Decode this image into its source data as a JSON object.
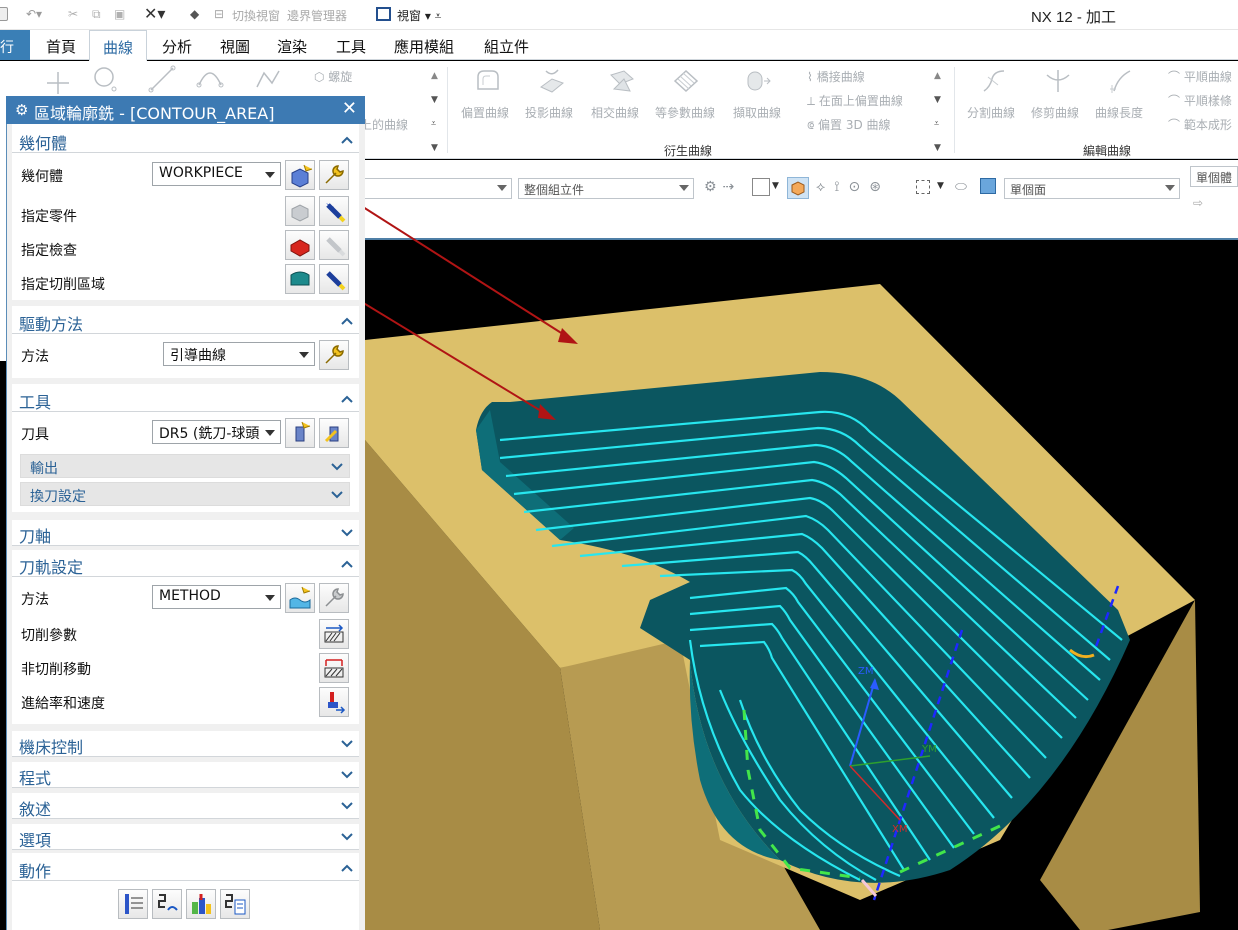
{
  "app": {
    "title": "NX 12 - 加工",
    "file_tab": "行"
  },
  "qat": {
    "switch_view_label": "切換視窗",
    "boundary_manager_label": "邊界管理器",
    "window_label": "視窗"
  },
  "menu": {
    "tabs": [
      "首頁",
      "曲線",
      "分析",
      "視圖",
      "渲染",
      "工具",
      "應用模組",
      "組立件"
    ],
    "active": "曲線"
  },
  "ribbon": {
    "misc_small": [
      "螺旋",
      "上的曲線"
    ],
    "derived": {
      "items": [
        "偏置曲線",
        "投影曲線",
        "相交曲線",
        "等參數曲線",
        "擷取曲線"
      ],
      "small": [
        "橋接曲線",
        "在面上偏置曲線",
        "偏置 3D 曲線"
      ],
      "group": "衍生曲線"
    },
    "edit": {
      "items": [
        "分割曲線",
        "修剪曲線",
        "曲線長度"
      ],
      "small": [
        "平順曲線",
        "平順樣條",
        "範本成形"
      ],
      "group": "編輯曲線"
    }
  },
  "selection": {
    "filter2": "整個組立件",
    "filter3": "單個面",
    "filter4": "單個體"
  },
  "dialog": {
    "title": "區域輪廓銑 - [CONTOUR_AREA]",
    "geometry": {
      "header": "幾何體",
      "geometry_label": "幾何體",
      "geometry_value": "WORKPIECE",
      "part_label": "指定零件",
      "check_label": "指定檢查",
      "cut_area_label": "指定切削區域"
    },
    "drive": {
      "header": "驅動方法",
      "method_label": "方法",
      "method_value": "引導曲線"
    },
    "tool": {
      "header": "工具",
      "tool_label": "刀具",
      "tool_value": "DR5 (銑刀-球頭",
      "output_label": "輸出",
      "tool_change_label": "換刀設定"
    },
    "axis": {
      "header": "刀軸"
    },
    "path": {
      "header": "刀軌設定",
      "method_label": "方法",
      "method_value": "METHOD",
      "cut_params_label": "切削參數",
      "non_cut_label": "非切削移動",
      "feeds_label": "進給率和速度"
    },
    "machine_control": {
      "header": "機床控制"
    },
    "program": {
      "header": "程式"
    },
    "description": {
      "header": "敘述"
    },
    "options": {
      "header": "選項"
    },
    "actions": {
      "header": "動作"
    }
  },
  "graphics": {
    "triad_labels": [
      "ZM",
      "YM",
      "XM"
    ]
  },
  "colors": {
    "accent": "#3d7ab3",
    "section_title": "#2b6296",
    "part_face": "#dcc06a",
    "part_side": "#a88c45",
    "pocket": "#0b5660",
    "toolpath": "#27e6ef",
    "arrow": "#b01414"
  }
}
